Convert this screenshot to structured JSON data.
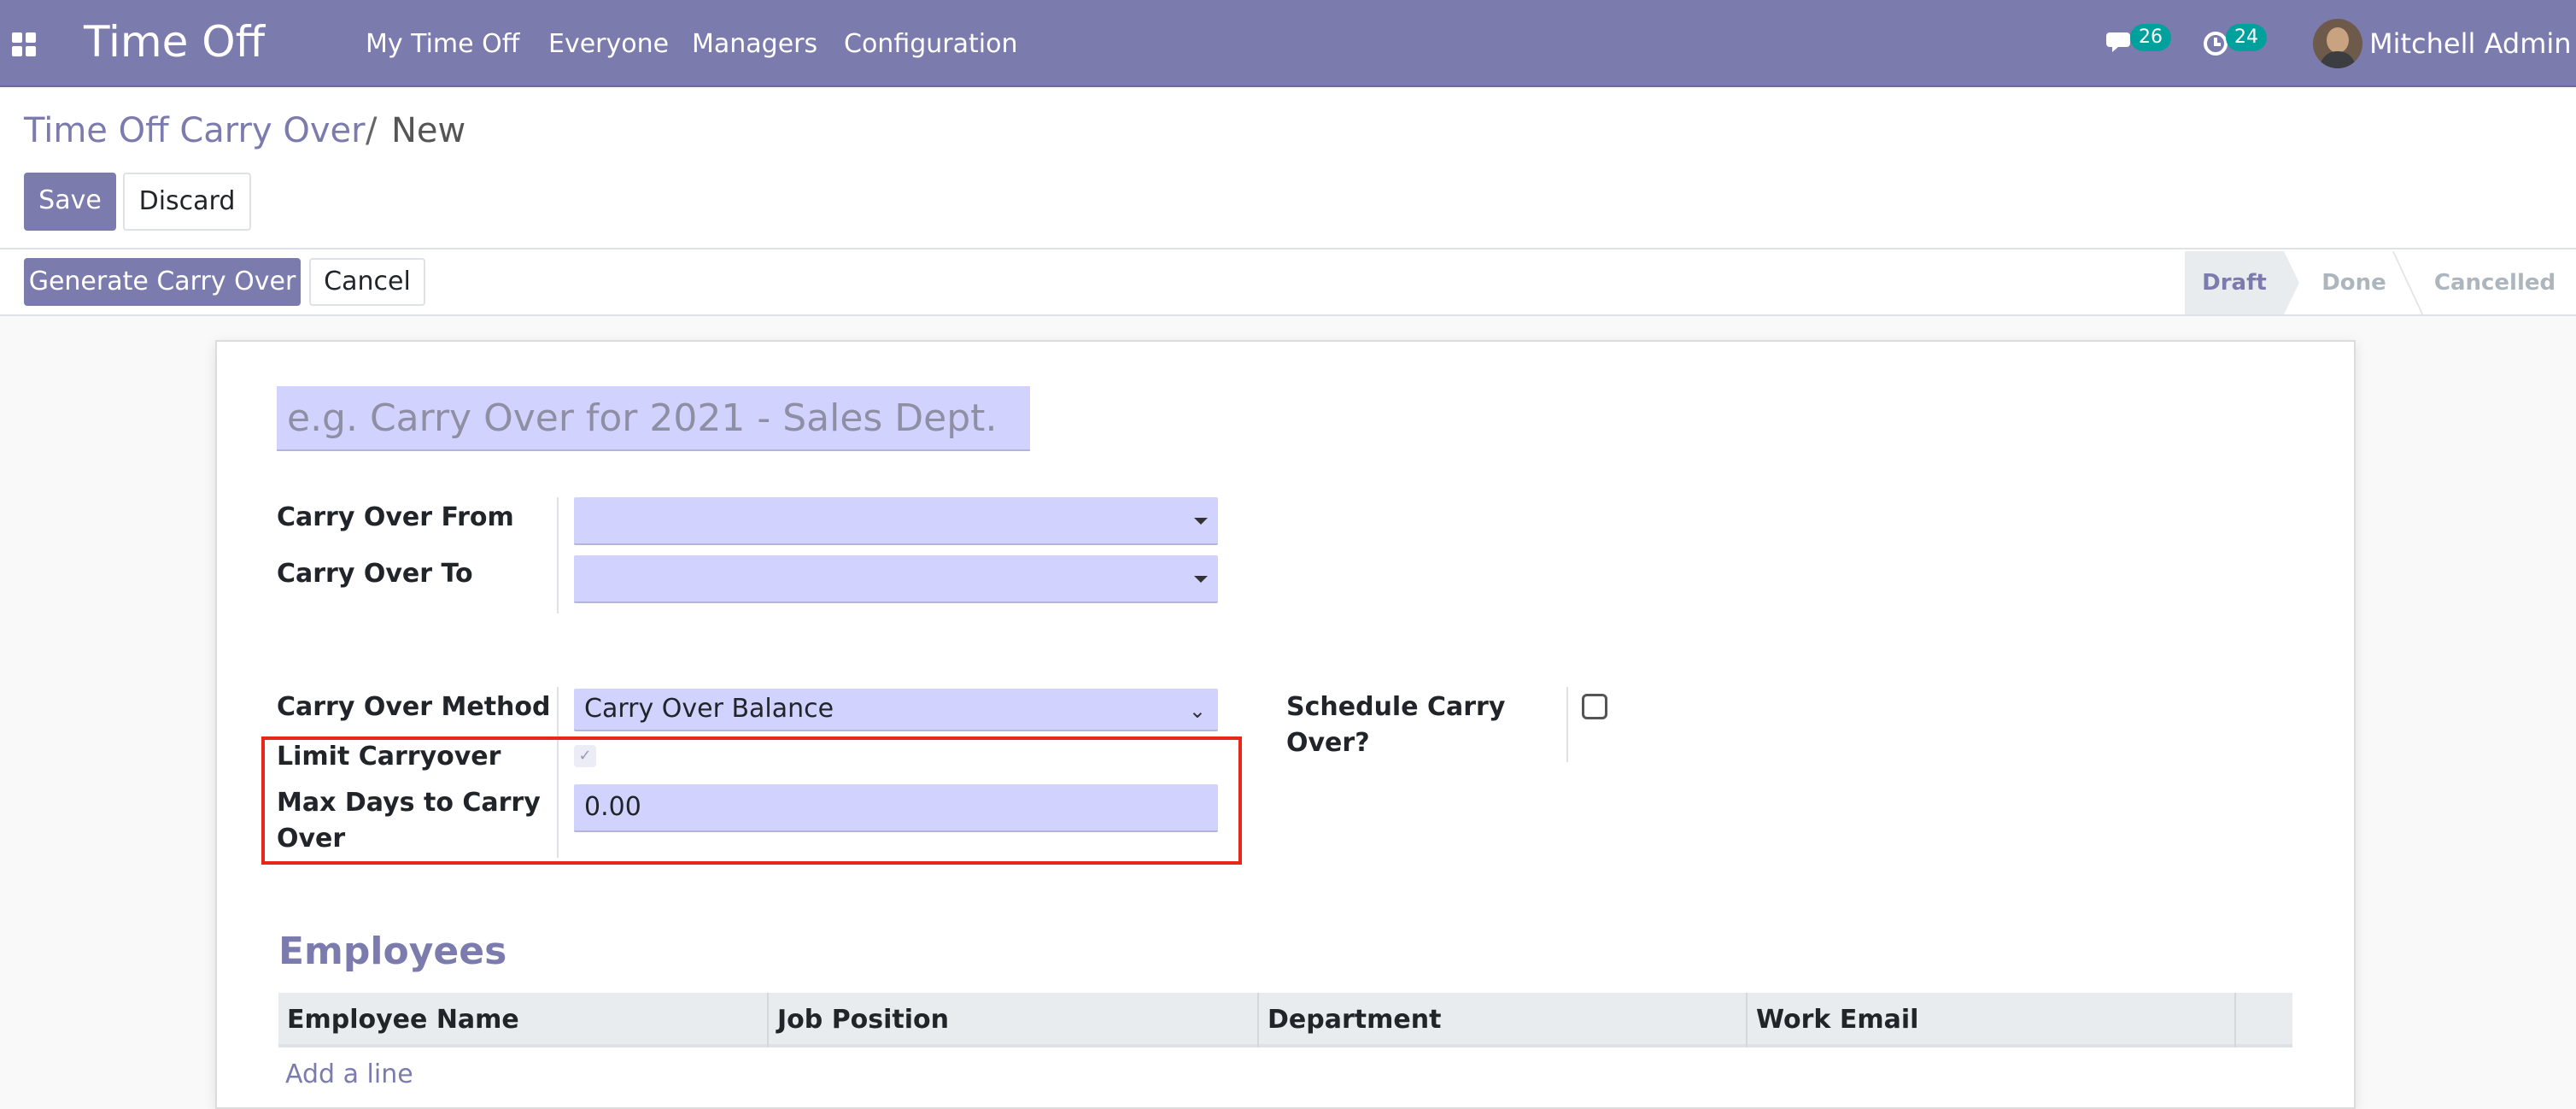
{
  "navbar": {
    "app_name": "Time Off",
    "menus": [
      "My Time Off",
      "Everyone",
      "Managers",
      "Configuration"
    ],
    "messages_count": "26",
    "activities_count": "24",
    "user_name": "Mitchell Admin",
    "color": "#7c7bad"
  },
  "breadcrumb": {
    "parent": "Time Off Carry Over",
    "separator": "/",
    "current": "New"
  },
  "toolbar": {
    "save_label": "Save",
    "discard_label": "Discard"
  },
  "header_buttons": {
    "generate_label": "Generate Carry Over",
    "cancel_label": "Cancel"
  },
  "statusbar": {
    "stages": [
      "Draft",
      "Done",
      "Cancelled"
    ],
    "active": "Draft"
  },
  "form": {
    "name_placeholder": "e.g. Carry Over for 2021 - Sales Dept.",
    "carry_over_from_label": "Carry Over From",
    "carry_over_from_value": "",
    "carry_over_to_label": "Carry Over To",
    "carry_over_to_value": "",
    "method_label": "Carry Over Method",
    "method_value": "Carry Over Balance",
    "limit_label": "Limit Carryover",
    "limit_checked": true,
    "max_days_label_line1": "Max Days to Carry",
    "max_days_label_line2": "Over",
    "max_days_value": "0.00",
    "schedule_label_line1": "Schedule Carry",
    "schedule_label_line2": "Over?",
    "schedule_checked": false
  },
  "employees": {
    "title": "Employees",
    "columns": [
      "Employee Name",
      "Job Position",
      "Department",
      "Work Email"
    ],
    "add_line": "Add a line"
  }
}
